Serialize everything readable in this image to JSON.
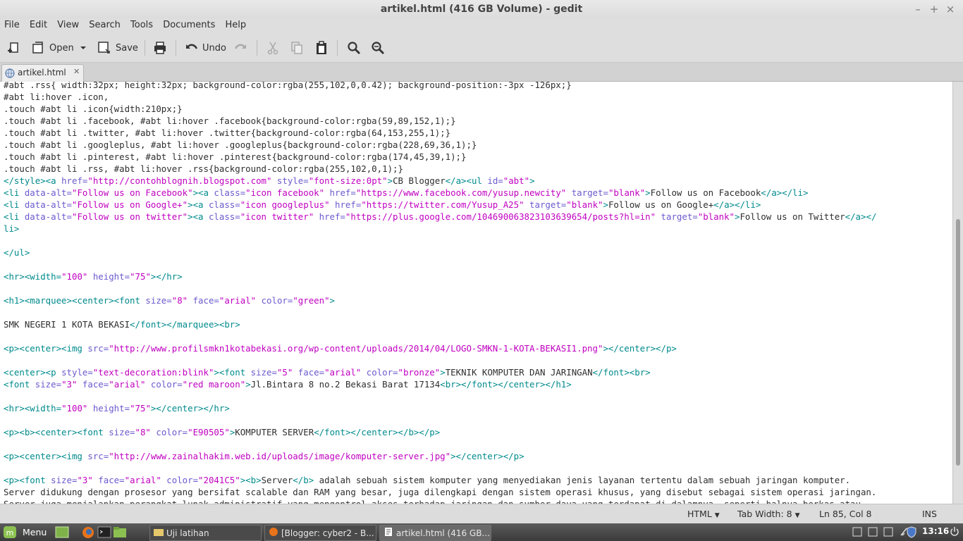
{
  "window": {
    "title": "artikel.html (416 GB Volume) - gedit"
  },
  "menu": [
    "File",
    "Edit",
    "View",
    "Search",
    "Tools",
    "Documents",
    "Help"
  ],
  "toolbar": {
    "open_label": "Open",
    "save_label": "Save",
    "undo_label": "Undo"
  },
  "tab": {
    "label": "artikel.html"
  },
  "code": [
    [
      [
        "x",
        "#abt .rss{ width:32px; height:32px; background-color:rgba(255,102,0,0.42); background-position:-3px -126px;}"
      ]
    ],
    [
      [
        "x",
        "#abt li:hover .icon,"
      ]
    ],
    [
      [
        "x",
        ".touch #abt li .icon{width:210px;}"
      ]
    ],
    [
      [
        "x",
        ".touch #abt li .facebook, #abt li:hover .facebook{background-color:rgba(59,89,152,1);}"
      ]
    ],
    [
      [
        "x",
        ".touch #abt li .twitter, #abt li:hover .twitter{background-color:rgba(64,153,255,1);}"
      ]
    ],
    [
      [
        "x",
        ".touch #abt li .googleplus, #abt li:hover .googleplus{background-color:rgba(228,69,36,1);}"
      ]
    ],
    [
      [
        "x",
        ".touch #abt li .pinterest, #abt li:hover .pinterest{background-color:rgba(174,45,39,1);}"
      ]
    ],
    [
      [
        "x",
        ".touch #abt li .rss, #abt li:hover .rss{background-color:rgba(255,102,0,1);}"
      ]
    ],
    [
      [
        "t",
        "</style><a "
      ],
      [
        "a",
        "href="
      ],
      [
        "s",
        "\"http://contohblognih.blogspot.com\""
      ],
      [
        "a",
        " style="
      ],
      [
        "s",
        "\"font-size:0pt\""
      ],
      [
        "t",
        ">"
      ],
      [
        "x",
        "CB Blogger"
      ],
      [
        "t",
        "</a><ul "
      ],
      [
        "a",
        "id="
      ],
      [
        "s",
        "\"abt\""
      ],
      [
        "t",
        ">"
      ]
    ],
    [
      [
        "t",
        "<li "
      ],
      [
        "a",
        "data-alt="
      ],
      [
        "s",
        "\"Follow us on Facebook\""
      ],
      [
        "t",
        "><a "
      ],
      [
        "a",
        "class="
      ],
      [
        "s",
        "\"icon facebook\""
      ],
      [
        "a",
        " href="
      ],
      [
        "s",
        "\"https://www.facebook.com/yusup.newcity\""
      ],
      [
        "a",
        " target="
      ],
      [
        "s",
        "\"blank\""
      ],
      [
        "t",
        ">"
      ],
      [
        "x",
        "Follow us on Facebook"
      ],
      [
        "t",
        "</a></li>"
      ]
    ],
    [
      [
        "t",
        "<li "
      ],
      [
        "a",
        "data-alt="
      ],
      [
        "s",
        "\"Follow us on Google+\""
      ],
      [
        "t",
        "><a "
      ],
      [
        "a",
        "class="
      ],
      [
        "s",
        "\"icon googleplus\""
      ],
      [
        "a",
        " href="
      ],
      [
        "s",
        "\"https://twitter.com/Yusup_A25\""
      ],
      [
        "a",
        " target="
      ],
      [
        "s",
        "\"blank\""
      ],
      [
        "t",
        ">"
      ],
      [
        "x",
        "Follow us on Google+"
      ],
      [
        "t",
        "</a></li>"
      ]
    ],
    [
      [
        "t",
        "<li "
      ],
      [
        "a",
        "data-alt="
      ],
      [
        "s",
        "\"Follow us on twitter\""
      ],
      [
        "t",
        "><a "
      ],
      [
        "a",
        "class="
      ],
      [
        "s",
        "\"icon twitter\""
      ],
      [
        "a",
        " href="
      ],
      [
        "s",
        "\"https://plus.google.com/104690063823103639654/posts?hl=in\""
      ],
      [
        "a",
        " target="
      ],
      [
        "s",
        "\"blank\""
      ],
      [
        "t",
        ">"
      ],
      [
        "x",
        "Follow us on Twitter"
      ],
      [
        "t",
        "</a></"
      ]
    ],
    [
      [
        "t",
        "li>"
      ]
    ],
    [],
    [
      [
        "t",
        "</ul>"
      ]
    ],
    [],
    [
      [
        "t",
        "<hr><width="
      ],
      [
        "s",
        "\"100\""
      ],
      [
        "a",
        " height="
      ],
      [
        "s",
        "\"75\""
      ],
      [
        "t",
        "></hr>"
      ]
    ],
    [],
    [
      [
        "t",
        "<h1><marquee><center><font "
      ],
      [
        "a",
        "size="
      ],
      [
        "s",
        "\"8\""
      ],
      [
        "a",
        " face="
      ],
      [
        "s",
        "\"arial\""
      ],
      [
        "a",
        " color="
      ],
      [
        "s",
        "\"green\""
      ],
      [
        "t",
        ">"
      ]
    ],
    [],
    [
      [
        "x",
        "SMK NEGERI 1 KOTA BEKASI"
      ],
      [
        "t",
        "</font></marquee><br>"
      ]
    ],
    [],
    [
      [
        "t",
        "<p><center><img "
      ],
      [
        "a",
        "src="
      ],
      [
        "s",
        "\"http://www.profilsmkn1kotabekasi.org/wp-content/uploads/2014/04/LOGO-SMKN-1-KOTA-BEKASI1.png\""
      ],
      [
        "t",
        "></center></p>"
      ]
    ],
    [],
    [
      [
        "t",
        "<center><p "
      ],
      [
        "a",
        "style="
      ],
      [
        "s",
        "\"text-decoration:blink\""
      ],
      [
        "t",
        "><font "
      ],
      [
        "a",
        "size="
      ],
      [
        "s",
        "\"5\""
      ],
      [
        "a",
        " face="
      ],
      [
        "s",
        "\"arial\""
      ],
      [
        "a",
        " color="
      ],
      [
        "s",
        "\"bronze\""
      ],
      [
        "t",
        ">"
      ],
      [
        "x",
        "TEKNIK KOMPUTER DAN JARINGAN"
      ],
      [
        "t",
        "</font><br>"
      ]
    ],
    [
      [
        "t",
        "<font "
      ],
      [
        "a",
        "size="
      ],
      [
        "s",
        "\"3\""
      ],
      [
        "a",
        " face="
      ],
      [
        "s",
        "\"arial\""
      ],
      [
        "a",
        " color="
      ],
      [
        "s",
        "\"red maroon\""
      ],
      [
        "t",
        ">"
      ],
      [
        "x",
        "Jl.Bintara 8 no.2 Bekasi Barat 17134"
      ],
      [
        "t",
        "<br></font></center></h1>"
      ]
    ],
    [],
    [
      [
        "t",
        "<hr><width="
      ],
      [
        "s",
        "\"100\""
      ],
      [
        "a",
        " height="
      ],
      [
        "s",
        "\"75\""
      ],
      [
        "t",
        "></center></hr>"
      ]
    ],
    [],
    [
      [
        "t",
        "<p><b><center><font "
      ],
      [
        "a",
        "size="
      ],
      [
        "s",
        "\"8\""
      ],
      [
        "a",
        " color="
      ],
      [
        "s",
        "\"E90505\""
      ],
      [
        "t",
        ">"
      ],
      [
        "x",
        "KOMPUTER SERVER"
      ],
      [
        "t",
        "</font></center></b></p>"
      ]
    ],
    [],
    [
      [
        "t",
        "<p><center><img "
      ],
      [
        "a",
        "src="
      ],
      [
        "s",
        "\"http://www.zainalhakim.web.id/uploads/image/komputer-server.jpg\""
      ],
      [
        "t",
        "></center></p>"
      ]
    ],
    [],
    [
      [
        "t",
        "<p><font "
      ],
      [
        "a",
        "size="
      ],
      [
        "s",
        "\"3\""
      ],
      [
        "a",
        " face="
      ],
      [
        "s",
        "\"arial\""
      ],
      [
        "a",
        " color="
      ],
      [
        "s",
        "\"2041C5\""
      ],
      [
        "t",
        "><b>"
      ],
      [
        "x",
        "Server"
      ],
      [
        "t",
        "</b>"
      ],
      [
        "x",
        " adalah sebuah sistem komputer yang menyediakan jenis layanan tertentu dalam sebuah jaringan komputer."
      ]
    ],
    [
      [
        "x",
        "Server didukung dengan prosesor yang bersifat scalable dan RAM yang besar, juga dilengkapi dengan sistem operasi khusus, yang disebut sebagai sistem operasi jaringan."
      ]
    ],
    [
      [
        "x",
        "Server juga menjalankan perangkat lunak administratif yang mengontrol akses terhadap jaringan dan sumber daya yang terdapat di dalamnya, seperti halnya berkas atau"
      ]
    ]
  ],
  "status": {
    "language": "HTML",
    "tab_width": "Tab Width:  8",
    "position": "Ln 85, Col 8",
    "mode": "INS"
  },
  "taskbar": {
    "menu_label": "Menu",
    "tasks": [
      "Uji latihan",
      "[Blogger: cyber2 - B...",
      "artikel.html (416 GB..."
    ],
    "clock": "13:16"
  },
  "colors": {
    "tag": "#008a8c",
    "attr": "#6a5acd",
    "string": "#c000c0"
  }
}
